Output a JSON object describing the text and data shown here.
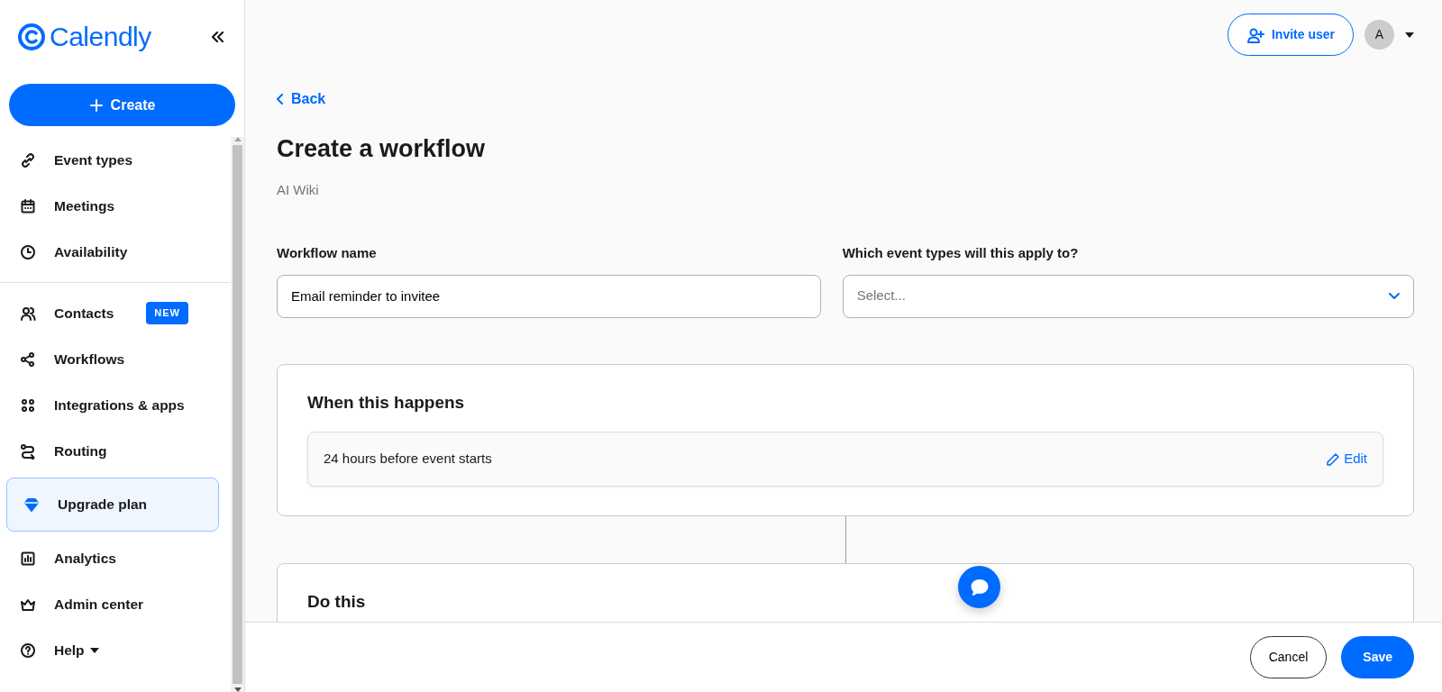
{
  "sidebar": {
    "logo": "Calendly",
    "create_button": "Create",
    "sections": [
      [
        {
          "label": "Event types",
          "kind": "link"
        },
        {
          "label": "Meetings",
          "kind": "link"
        },
        {
          "label": "Availability",
          "kind": "link"
        }
      ],
      [
        {
          "label": "Contacts",
          "kind": "link",
          "badge": "NEW"
        },
        {
          "label": "Workflows",
          "kind": "link"
        },
        {
          "label": "Integrations & apps",
          "kind": "link"
        },
        {
          "label": "Routing",
          "kind": "link"
        },
        {
          "label": "Upgrade plan",
          "kind": "upgrade"
        },
        {
          "label": "Analytics",
          "kind": "link"
        },
        {
          "label": "Admin center",
          "kind": "link"
        },
        {
          "label": "Help",
          "kind": "menu"
        }
      ]
    ]
  },
  "header": {
    "invite_button": "Invite user",
    "avatar": "A"
  },
  "page": {
    "back": "Back",
    "title": "Create a workflow",
    "subtitle": "AI Wiki",
    "workflow_name": {
      "label": "Workflow name",
      "value": "Email reminder to invitee"
    },
    "event_types": {
      "label": "Which event types will this apply to?",
      "placeholder": "Select..."
    },
    "trigger": {
      "title": "When this happens",
      "value": "24 hours before event starts",
      "edit": "Edit"
    },
    "action": {
      "title": "Do this"
    }
  },
  "footer": {
    "cancel": "Cancel",
    "save": "Save"
  }
}
